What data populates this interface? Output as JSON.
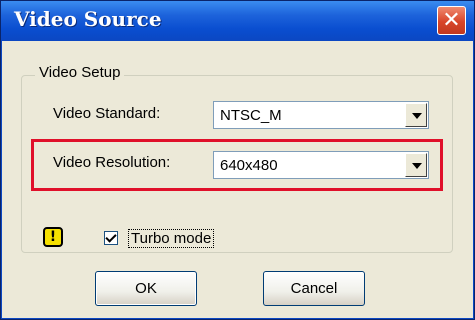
{
  "window": {
    "title": "Video Source"
  },
  "group": {
    "legend": "Video Setup",
    "video_standard": {
      "label": "Video Standard:",
      "value": "NTSC_M"
    },
    "video_resolution": {
      "label": "Video Resolution:",
      "value": "640x480"
    }
  },
  "turbo": {
    "label": "Turbo mode",
    "checked": true
  },
  "buttons": {
    "ok": "OK",
    "cancel": "Cancel"
  },
  "colors": {
    "titlebar": "#0a4ed0",
    "highlight": "#e0102a",
    "warning": "#f5e000"
  }
}
